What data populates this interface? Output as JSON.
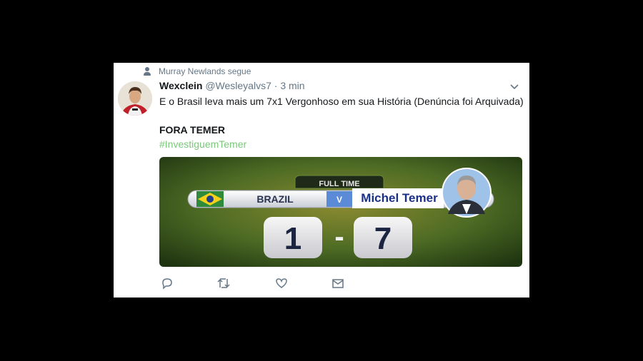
{
  "context": {
    "text": "Murray Newlands segue",
    "icon": "person-icon"
  },
  "tweet": {
    "author_name": "Wexclein",
    "handle": "@Wesleyalvs7",
    "separator": "·",
    "time": "3 min",
    "line1": "E o Brasil leva mais um 7x1 Vergonhoso em sua História  (Denúncia foi Arquivada)",
    "line2": "FORA TEMER",
    "hashtag": "#InvestiguemTemer"
  },
  "media": {
    "banner": "FULL TIME",
    "team_home": "BRAZIL",
    "versus": "V",
    "team_away": "Michel Temer",
    "score_home": "1",
    "score_dash": "-",
    "score_away": "7"
  },
  "actions": [
    "reply-icon",
    "retweet-icon",
    "like-icon",
    "dm-icon"
  ],
  "colors": {
    "hashtag": "#78c878",
    "secondary_text": "#657786",
    "pitch": "#3c5a1c"
  }
}
